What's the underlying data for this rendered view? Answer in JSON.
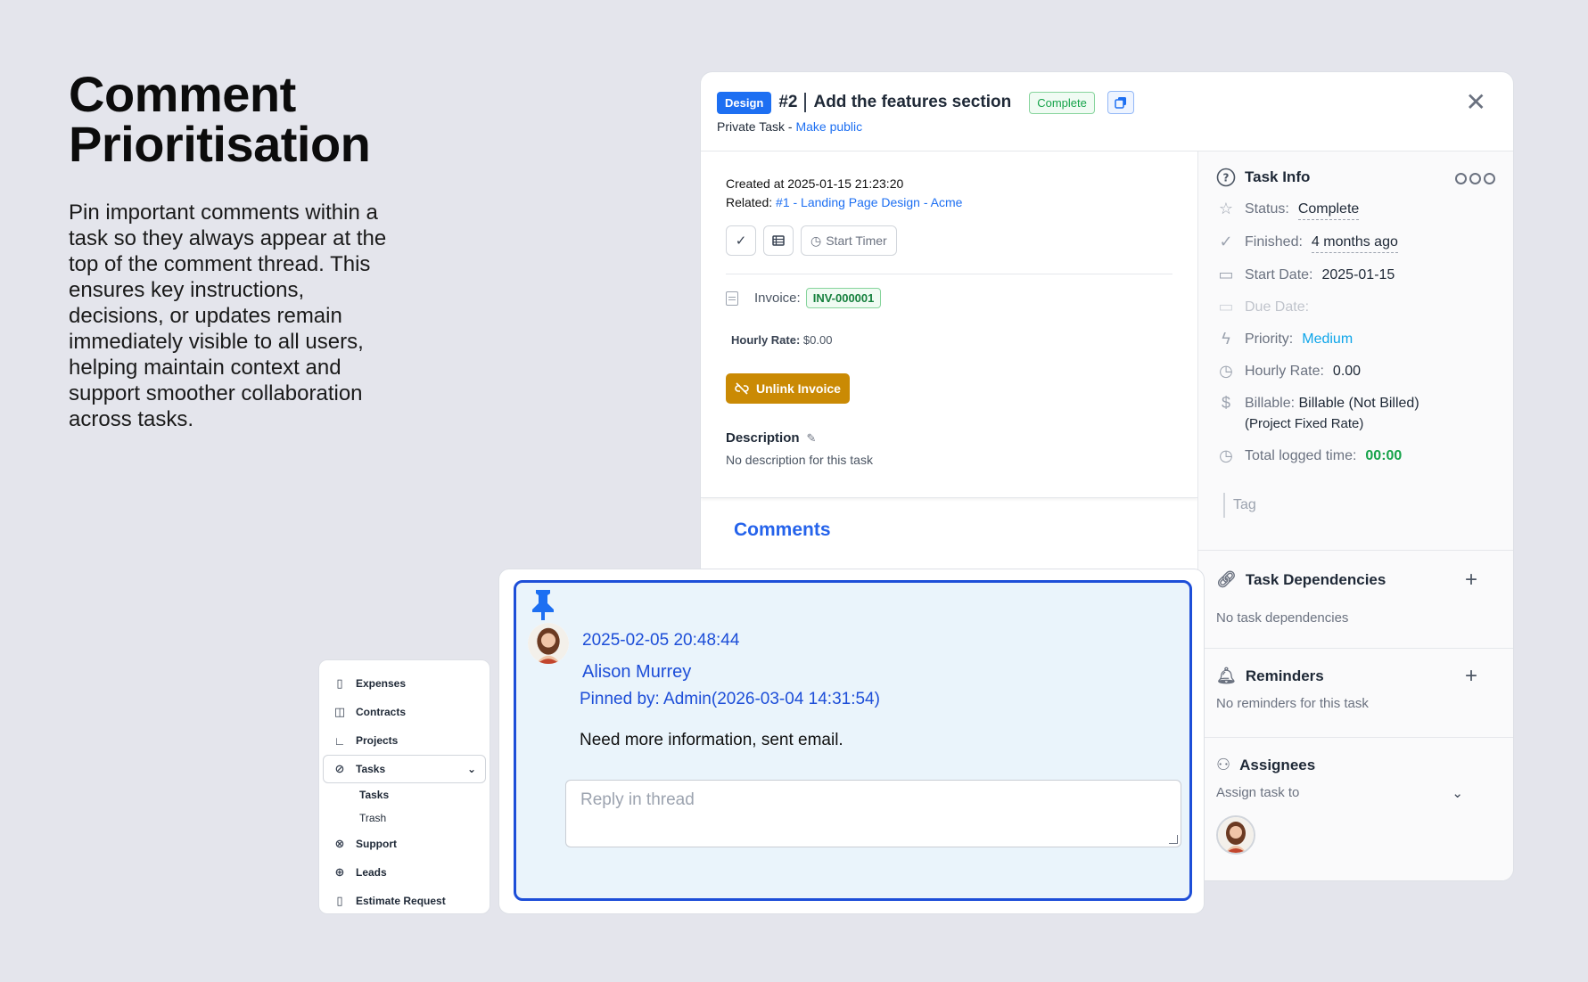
{
  "hero": {
    "title": "Comment Prioritisation",
    "description": "Pin important comments within a task so they always appear at the top of the comment thread. This ensures key instructions, decisions, or updates remain immediately visible to all users, helping maintain context and support smoother collaboration across tasks."
  },
  "task": {
    "category_badge": "Design",
    "number": "#2",
    "name": "Add the features section",
    "status_badge": "Complete",
    "visibility": "Private Task",
    "visibility_sep": " - ",
    "make_public": "Make public",
    "created_label": "Created at",
    "created_value": "2025-01-15 21:23:20",
    "related_label": "Related:",
    "related_link": "#1 - Landing Page Design - Acme",
    "start_timer": "Start Timer",
    "invoice_label": "Invoice:",
    "invoice_value": "INV-000001",
    "hourly_label": "Hourly Rate:",
    "hourly_value": "$0.00",
    "unlink_invoice": "Unlink Invoice",
    "description_title": "Description",
    "description_text": "No description for this task",
    "comments_title": "Comments"
  },
  "info": {
    "title": "Task Info",
    "status_label": "Status:",
    "status_value": "Complete",
    "finished_label": "Finished:",
    "finished_value": "4 months ago",
    "start_label": "Start Date:",
    "start_value": "2025-01-15",
    "due_label": "Due Date:",
    "priority_label": "Priority:",
    "priority_value": "Medium",
    "hourly_label": "Hourly Rate:",
    "hourly_value": "0.00",
    "billable_label": "Billable:",
    "billable_value": "Billable (Not Billed)",
    "billable_note": "(Project Fixed Rate)",
    "logged_label": "Total logged time:",
    "logged_value": "00:00",
    "tag_placeholder": "Tag",
    "dependencies_title": "Task Dependencies",
    "dependencies_empty": "No task dependencies",
    "reminders_title": "Reminders",
    "reminders_empty": "No reminders for this task",
    "assignees_title": "Assignees",
    "assign_placeholder": "Assign task to"
  },
  "sidebar": {
    "items": [
      {
        "label": "Expenses"
      },
      {
        "label": "Contracts"
      },
      {
        "label": "Projects"
      },
      {
        "label": "Tasks"
      },
      {
        "label": "Support"
      },
      {
        "label": "Leads"
      },
      {
        "label": "Estimate Request"
      }
    ],
    "sub_items": [
      {
        "label": "Tasks"
      },
      {
        "label": "Trash"
      }
    ]
  },
  "comment": {
    "date": "2025-02-05 20:48:44",
    "author": "Alison Murrey",
    "pinned_by": "Pinned by: Admin(2026-03-04 14:31:54)",
    "text": "Need more information, sent email.",
    "reply_placeholder": "Reply in thread"
  },
  "colors": {
    "accent": "#1d6ff2",
    "pin_border": "#1d4ed8",
    "pinned_bg": "#eaf4fb",
    "unlink": "#ca8a04",
    "success": "#16a34a"
  }
}
